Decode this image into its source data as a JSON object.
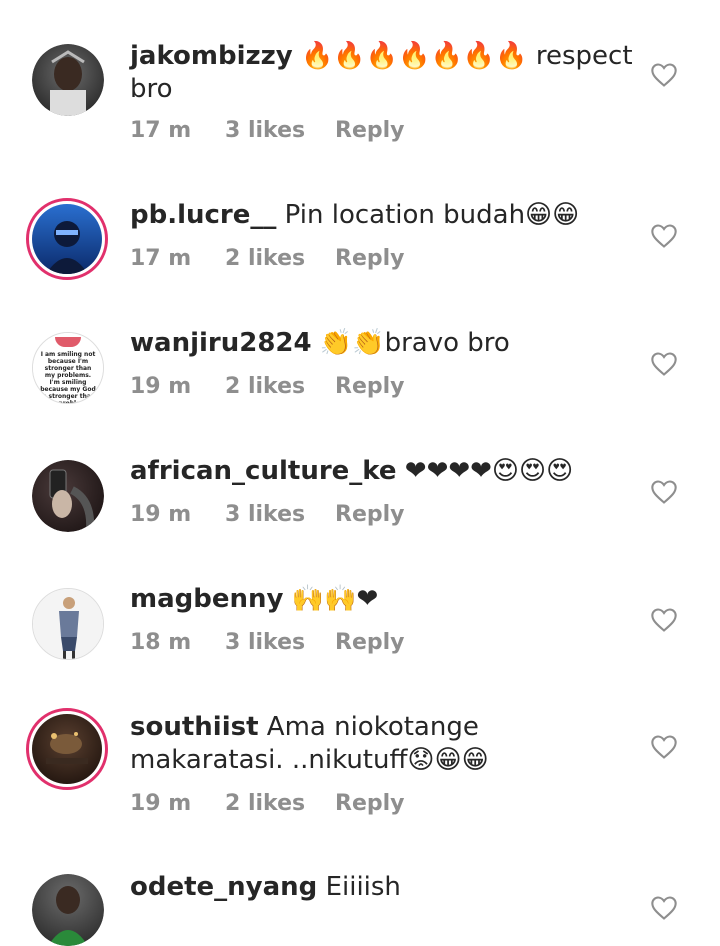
{
  "comments": [
    {
      "user": "jakombizzy",
      "text": "🔥🔥🔥🔥🔥🔥🔥 respect bro",
      "time": "17 m",
      "likes": "3 likes",
      "reply": "Reply"
    },
    {
      "user": "pb.lucre__",
      "text": "Pin location budah😁😁",
      "time": "17 m",
      "likes": "2 likes",
      "reply": "Reply"
    },
    {
      "user": "wanjiru2824",
      "text": "👏👏bravo bro",
      "time": "19 m",
      "likes": "2 likes",
      "reply": "Reply"
    },
    {
      "user": "african_culture_ke",
      "text": "❤❤❤❤😍😍😍",
      "time": "19 m",
      "likes": "3 likes",
      "reply": "Reply"
    },
    {
      "user": "magbenny",
      "text": "🙌🙌❤",
      "time": "18 m",
      "likes": "3 likes",
      "reply": "Reply"
    },
    {
      "user": "southiist",
      "text": "Ama niokotange makaratasi. ..nikutuff😟😁😁",
      "time": "19 m",
      "likes": "2 likes",
      "reply": "Reply"
    },
    {
      "user": "odete_nyang",
      "text": "Eiiiish"
    }
  ],
  "avatar3_text": "I am smiling not because I'm stronger than my problems. I'm smiling because my God is stronger than my problems"
}
